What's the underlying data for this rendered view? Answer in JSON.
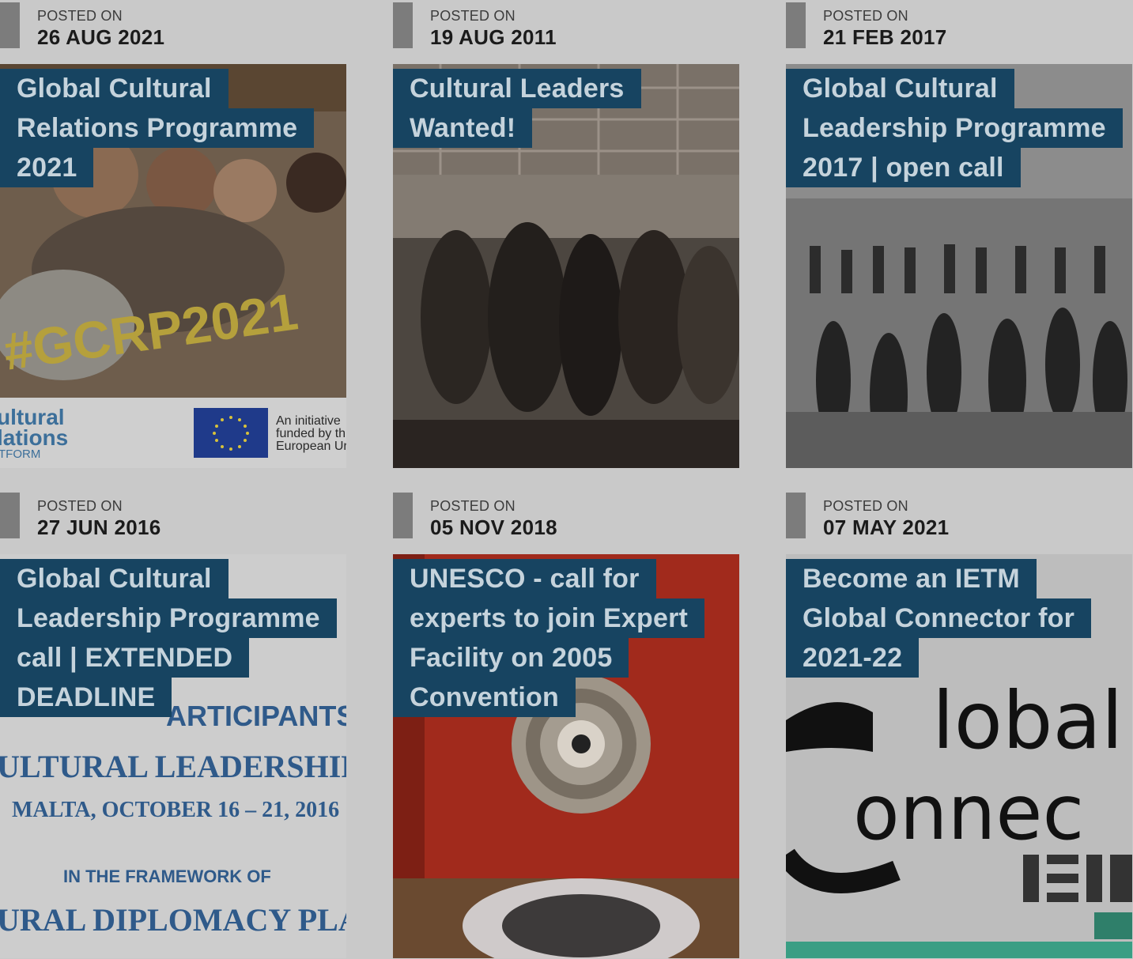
{
  "posts": [
    {
      "posted_label": "POSTED ON",
      "date": "26 AUG 2021",
      "title_lines": [
        "Global Cultural",
        "Relations Programme",
        "2021"
      ],
      "image_texts": {
        "hashtag": "#GCRP2021",
        "platform_line1": "ultural",
        "platform_line2": "lations",
        "platform_line3": "TFORM",
        "eu_line1": "An initiative",
        "eu_line2": "funded by th",
        "eu_line3": "European Ur"
      }
    },
    {
      "posted_label": "POSTED ON",
      "date": "19 AUG 2011",
      "title_lines": [
        "Cultural Leaders",
        "Wanted!"
      ]
    },
    {
      "posted_label": "POSTED ON",
      "date": "21 FEB 2017",
      "title_lines": [
        "Global Cultural",
        "Leadership Programme",
        "2017 | open call"
      ]
    },
    {
      "posted_label": "POSTED ON",
      "date": "27 JUN 2016",
      "title_lines": [
        "Global Cultural",
        "Leadership Programme",
        "call | EXTENDED",
        "DEADLINE"
      ],
      "image_texts": {
        "line1": "ARTICIPANTS",
        "line2": "ULTURAL LEADERSHIP PR",
        "line3": "MALTA, OCTOBER 16 – 21, 2016",
        "line4": "IN THE FRAMEWORK OF",
        "line5": "URAL DIPLOMACY PLATF"
      }
    },
    {
      "posted_label": "POSTED ON",
      "date": "05 NOV 2018",
      "title_lines": [
        "UNESCO - call for",
        "experts to join Expert",
        "Facility on 2005",
        "Convention"
      ]
    },
    {
      "posted_label": "POSTED ON",
      "date": "07 MAY 2021",
      "title_lines": [
        "Become an IETM",
        "Global Connector for",
        "2021-22"
      ],
      "image_texts": {
        "word1": "lobal",
        "word2": "onnec"
      }
    }
  ],
  "colors": {
    "title_bg": "#174461",
    "title_text": "#c5d3dc",
    "date_bar": "#7c7c7c",
    "page_bg": "#c9c9c9"
  }
}
